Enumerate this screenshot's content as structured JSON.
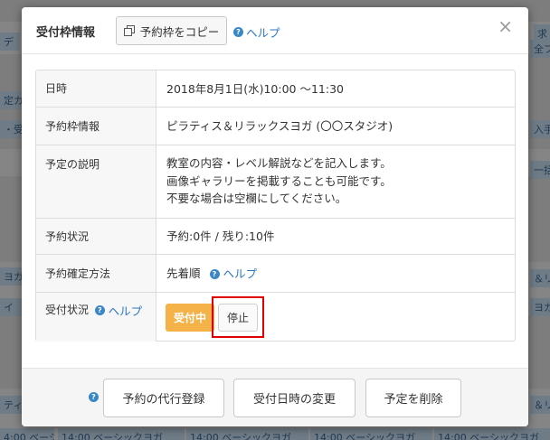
{
  "background": {
    "fragments": [
      {
        "text": "デ",
        "l": 0,
        "t": 36,
        "w": 22
      },
      {
        "text": "全フ",
        "l": 586,
        "t": 44,
        "w": 22
      },
      {
        "text": "求",
        "l": 590,
        "t": 27,
        "w": 18
      },
      {
        "text": "定カ",
        "l": 0,
        "t": 101,
        "w": 24
      },
      {
        "text": "・受",
        "l": 0,
        "t": 133,
        "w": 24
      },
      {
        "text": "入手",
        "l": 586,
        "t": 133,
        "w": 22
      },
      {
        "text": "一括",
        "l": 586,
        "t": 178,
        "w": 22
      },
      {
        "text": "ヨガ",
        "l": 0,
        "t": 296,
        "w": 24
      },
      {
        "text": "＆リ",
        "l": 586,
        "t": 298,
        "w": 22
      },
      {
        "text": "イ",
        "l": 0,
        "t": 330,
        "w": 24
      },
      {
        "text": "ヨガ",
        "l": 586,
        "t": 330,
        "w": 22
      },
      {
        "text": "ティ",
        "l": 0,
        "t": 438,
        "w": 24
      },
      {
        "text": "＆リ",
        "l": 586,
        "t": 438,
        "w": 22
      },
      {
        "text": "4:00 ベーシックヨガ",
        "l": 0,
        "t": 474,
        "w": 60
      },
      {
        "text": "14:00 ベーシックヨガ",
        "l": 64,
        "t": 474,
        "w": 140
      },
      {
        "text": "14:00 ベーシックヨガ",
        "l": 206,
        "t": 474,
        "w": 135
      },
      {
        "text": "14:00 ベーシックヨガ",
        "l": 343,
        "t": 474,
        "w": 135
      },
      {
        "text": "14:00 ベーシックヨガ",
        "l": 480,
        "t": 474,
        "w": 128
      }
    ]
  },
  "header": {
    "title": "受付枠情報",
    "copy_button_label": "予約枠をコピー",
    "help_label": "ヘルプ",
    "close_label": "×"
  },
  "details": {
    "datetime_label": "日時",
    "datetime_value": "2018年8月1日(水)10:00 ～11:30",
    "slot_label": "予約枠情報",
    "slot_value": "ピラティス＆リラックスヨガ (〇〇スタジオ)",
    "description_label": "予定の説明",
    "description_lines": [
      "教室の内容・レベル解説などを記入します。",
      "画像ギャラリーを掲載することも可能です。",
      "不要な場合は空欄にしてください。"
    ],
    "status_label": "予約状況",
    "status_value": "予約:0件 / 残り:10件",
    "method_label": "予約確定方法",
    "method_value": "先着順",
    "method_help": "ヘルプ",
    "accept_label": "受付状況",
    "accept_help": "ヘルプ",
    "accept_on_label": "受付中",
    "accept_stop_label": "停止"
  },
  "footer": {
    "proxy_button": "予約の代行登録",
    "change_button": "受付日時の変更",
    "delete_button": "予定を削除"
  },
  "colors": {
    "accent": "#f4b248",
    "link": "#2a76c6",
    "highlight": "#e00000"
  }
}
